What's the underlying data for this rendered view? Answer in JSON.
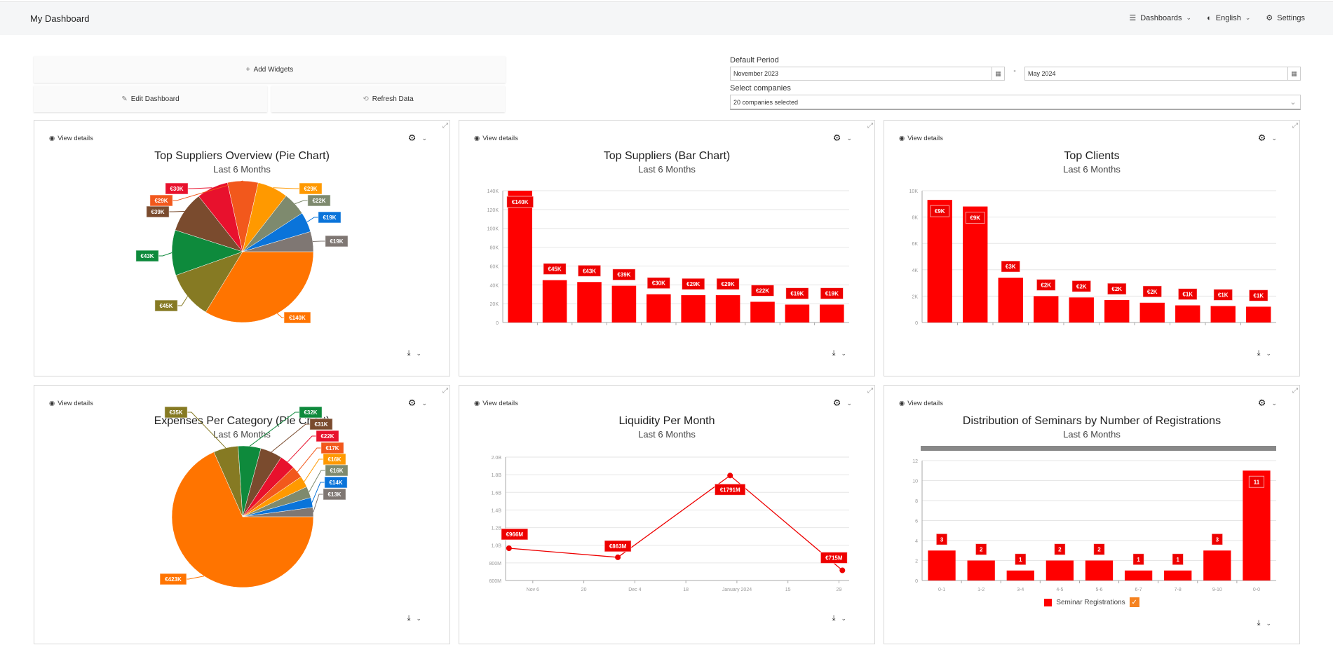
{
  "header": {
    "title": "My Dashboard",
    "nav": [
      {
        "icon": "list-icon",
        "label": "Dashboards",
        "dropdown": true
      },
      {
        "icon": "globe-icon",
        "label": "English",
        "dropdown": true
      },
      {
        "icon": "gear-icon",
        "label": "Settings",
        "dropdown": false
      }
    ]
  },
  "actions": {
    "add_widgets": "Add Widgets",
    "edit_dashboard": "Edit Dashboard",
    "refresh_data": "Refresh Data"
  },
  "filters": {
    "period_label": "Default Period",
    "from": "November 2023",
    "separator": "-",
    "to": "May 2024",
    "companies_label": "Select companies",
    "companies_value": "20 companies selected"
  },
  "widget_common": {
    "view_details": "View details"
  },
  "colors": {
    "bar": "#ff0000",
    "label_bg": "#ee0000"
  },
  "chart_data": [
    {
      "id": "top-suppliers-pie",
      "type": "pie",
      "title": "Top Suppliers Overview (Pie Chart)",
      "subtitle": "Last 6 Months",
      "slices": [
        {
          "value": 140,
          "label": "€140K",
          "color": "#ff7400"
        },
        {
          "value": 45,
          "label": "€45K",
          "color": "#867a23"
        },
        {
          "value": 43,
          "label": "€43K",
          "color": "#0e8a3c"
        },
        {
          "value": 39,
          "label": "€39K",
          "color": "#7a4b2e"
        },
        {
          "value": 30,
          "label": "€30K",
          "color": "#e8112d"
        },
        {
          "value": 29,
          "label": "€29K",
          "color": "#f2581c"
        },
        {
          "value": 29,
          "label": "€29K",
          "color": "#ff9900"
        },
        {
          "value": 22,
          "label": "€22K",
          "color": "#7e8a6e"
        },
        {
          "value": 19,
          "label": "€19K",
          "color": "#0a74da"
        },
        {
          "value": 19,
          "label": "€19K",
          "color": "#7f7773"
        }
      ]
    },
    {
      "id": "top-suppliers-bar",
      "type": "bar",
      "title": "Top Suppliers (Bar Chart)",
      "subtitle": "Last 6 Months",
      "categories": [
        "",
        "",
        "",
        "",
        "",
        "",
        "",
        "",
        "",
        ""
      ],
      "values": [
        140,
        45,
        43,
        39,
        30,
        29,
        29,
        22,
        19,
        19
      ],
      "labels": [
        "€140K",
        "€45K",
        "€43K",
        "€39K",
        "€30K",
        "€29K",
        "€29K",
        "€22K",
        "€19K",
        "€19K"
      ],
      "yticks": [
        "0",
        "20K",
        "40K",
        "60K",
        "80K",
        "100K",
        "120K",
        "140K"
      ],
      "ylim": [
        0,
        140
      ],
      "unit": "thousand EUR"
    },
    {
      "id": "top-clients-bar",
      "type": "bar",
      "title": "Top Clients",
      "subtitle": "Last 6 Months",
      "categories": [
        "",
        "",
        "",
        "",
        "",
        "",
        "",
        "",
        "",
        ""
      ],
      "values": [
        9.3,
        8.8,
        3.4,
        2.0,
        1.9,
        1.7,
        1.5,
        1.3,
        1.25,
        1.2
      ],
      "labels": [
        "€9K",
        "€9K",
        "€3K",
        "€2K",
        "€2K",
        "€2K",
        "€2K",
        "€1K",
        "€1K",
        "€1K"
      ],
      "yticks": [
        "0",
        "2K",
        "4K",
        "6K",
        "8K",
        "10K"
      ],
      "ylim": [
        0,
        10
      ],
      "unit": "thousand EUR"
    },
    {
      "id": "expenses-pie",
      "type": "pie",
      "title": "Expenses Per Category (Pie Chart)",
      "subtitle": "Last 6 Months",
      "slices": [
        {
          "value": 423,
          "label": "€423K",
          "color": "#ff7400"
        },
        {
          "value": 35,
          "label": "€35K",
          "color": "#867a23"
        },
        {
          "value": 32,
          "label": "€32K",
          "color": "#0e8a3c"
        },
        {
          "value": 31,
          "label": "€31K",
          "color": "#7a4b2e"
        },
        {
          "value": 22,
          "label": "€22K",
          "color": "#e8112d"
        },
        {
          "value": 17,
          "label": "€17K",
          "color": "#f2581c"
        },
        {
          "value": 16,
          "label": "€16K",
          "color": "#ff9900"
        },
        {
          "value": 16,
          "label": "€16K",
          "color": "#7e8a6e"
        },
        {
          "value": 14,
          "label": "€14K",
          "color": "#0a74da"
        },
        {
          "value": 13,
          "label": "€13K",
          "color": "#7f7773"
        }
      ]
    },
    {
      "id": "liquidity-line",
      "type": "line",
      "title": "Liquidity Per Month",
      "subtitle": "Last 6 Months",
      "points": [
        {
          "x": 0,
          "y": 966,
          "label": "€966M"
        },
        {
          "x": 32,
          "y": 863,
          "label": "€863M"
        },
        {
          "x": 65,
          "y": 1791,
          "label": "€1791M"
        },
        {
          "x": 98,
          "y": 715,
          "label": "€715M"
        }
      ],
      "xticks": [
        {
          "x": 7,
          "label": "Nov 6"
        },
        {
          "x": 22,
          "label": "20"
        },
        {
          "x": 37,
          "label": "Dec 4"
        },
        {
          "x": 52,
          "label": "18"
        },
        {
          "x": 67,
          "label": "January 2024"
        },
        {
          "x": 82,
          "label": "15"
        },
        {
          "x": 97,
          "label": "29"
        }
      ],
      "xlim": [
        -1,
        100
      ],
      "yticks": [
        "600M",
        "800M",
        "1.0B",
        "1.2B",
        "1.4B",
        "1.6B",
        "1.8B",
        "2.0B"
      ],
      "ylim": [
        600,
        2000
      ],
      "unit": "million EUR"
    },
    {
      "id": "seminars-bar",
      "type": "bar",
      "title": "Distribution of Seminars by Number of Registrations",
      "subtitle": "Last 6 Months",
      "categories": [
        "0-1",
        "1-2",
        "3-4",
        "4-5",
        "5-6",
        "6-7",
        "7-8",
        "9-10",
        "0-0"
      ],
      "values": [
        3,
        2,
        1,
        2,
        2,
        1,
        1,
        3,
        11
      ],
      "labels": [
        "3",
        "2",
        "1",
        "2",
        "2",
        "1",
        "1",
        "3",
        "11"
      ],
      "yticks": [
        "0",
        "2",
        "4",
        "6",
        "8",
        "10",
        "12"
      ],
      "ylim": [
        0,
        12
      ],
      "legend": {
        "label": "Seminar Registrations",
        "position": "bottom"
      }
    }
  ]
}
